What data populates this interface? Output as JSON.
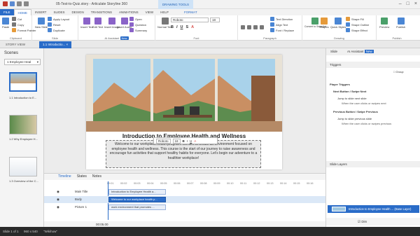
{
  "app": {
    "title": "05-Test-to-Quiz.story - Articulate Storyline 360",
    "context_tab": "DRAWING TOOLS"
  },
  "tabs": [
    "FILE",
    "HOME",
    "INSERT",
    "SLIDES",
    "DESIGN",
    "TRANSITIONS",
    "ANIMATIONS",
    "VIEW",
    "HELP",
    "FORMAT"
  ],
  "ribbon": {
    "clipboard": {
      "label": "Clipboard",
      "paste": "Paste",
      "cut": "Cut",
      "copy": "Copy",
      "format_painter": "Format Painter"
    },
    "slide": {
      "label": "Slide",
      "new_slide": "New Slide",
      "apply_layout": "Apply Layout",
      "reset": "Reset",
      "duplicate": "Duplicate"
    },
    "ai": {
      "label": "AI Assistant",
      "badge": "New",
      "insert_text": "Insert Text",
      "edit_text": "Edit Text",
      "insert_image": "Insert Image",
      "insert_audio": "Insert Audio",
      "rewrite": "Rewrite",
      "open": "Open",
      "question": "Question",
      "summary": "Summary"
    },
    "font": {
      "label": "Font",
      "name": "Roboto",
      "size": "18",
      "normal_text": "Normal Text"
    },
    "paragraph": {
      "label": "Paragraph",
      "text_direction": "Text Direction",
      "align_text": "Align Text",
      "font_replace": "Font / Replace",
      "convert": "Convert to SmartArt"
    },
    "drawing": {
      "label": "Drawing",
      "shapes": "Shapes",
      "quick_styles": "Quick Styles",
      "shape_fill": "Shape Fill",
      "shape_outline": "Shape Outline",
      "shape_effect": "Shape Effect"
    },
    "publish": {
      "label": "Publish",
      "preview": "Preview",
      "publish": "Publish"
    }
  },
  "doctabs": {
    "story_view": "STORY VIEW",
    "current": "1.1 Introductio..."
  },
  "scenes": {
    "header": "Scenes",
    "dropdown": "1 Employee Heal",
    "thumbs": [
      {
        "label": "1.1 Introduction to E..."
      },
      {
        "label": "1.2 Why Employee H..."
      },
      {
        "label": "1.3 Overview of the C..."
      }
    ]
  },
  "slide": {
    "title": "Introduction to Employee Health and Wellness",
    "body": "Welcome to our workplace health program! We aim to create an environment focused on employee health and wellness. This course is the start of our journey to raise awareness and encourage fun activities that support healthy habits for everyone. Let's begin our adventure to a healthier workplace!"
  },
  "floatbar": {
    "font": "Roboto",
    "size": "18"
  },
  "timeline": {
    "tabs": [
      "Timeline",
      "States",
      "Notes"
    ],
    "ticks": [
      "00:01",
      "00:02",
      "00:03",
      "00:04",
      "00:05",
      "00:06",
      "00:07",
      "00:08",
      "00:09",
      "00:10",
      "00:11",
      "00:12",
      "00:13",
      "00:14",
      "00:15",
      "00:16"
    ],
    "rows": [
      {
        "name": "Main Title",
        "bar": "Introduction to Employee Health a..."
      },
      {
        "name": "Body",
        "bar": "Welcome to our workplace health p..."
      },
      {
        "name": "Picture 1",
        "bar": "work environment that promotes ..."
      }
    ],
    "time": "00:05.00"
  },
  "right": {
    "tab_slide": "Slide",
    "tab_ai": "AI Assistant",
    "tab_ai_badge": "New",
    "triggers_header": "Triggers",
    "player_triggers": "Player Triggers",
    "group_label": "Group",
    "next_head": "Next Button / Swipe Next",
    "next_action": "Jump to slide next slide",
    "next_when": "When the user clicks or swipes next",
    "prev_head": "Previous Button / Swipe Previous",
    "prev_action": "Jump to slide previous slide",
    "prev_when": "When the user clicks or swipes previous",
    "layers_header": "Slide Layers",
    "base_layer": "Introduction to Employee Health ...",
    "base_tag": "(Base Layer)",
    "dim_label": "Dim"
  },
  "status": {
    "slide": "Slide 1 of 1",
    "size": "960 x 540",
    "theme": "\"Wikihow\""
  }
}
